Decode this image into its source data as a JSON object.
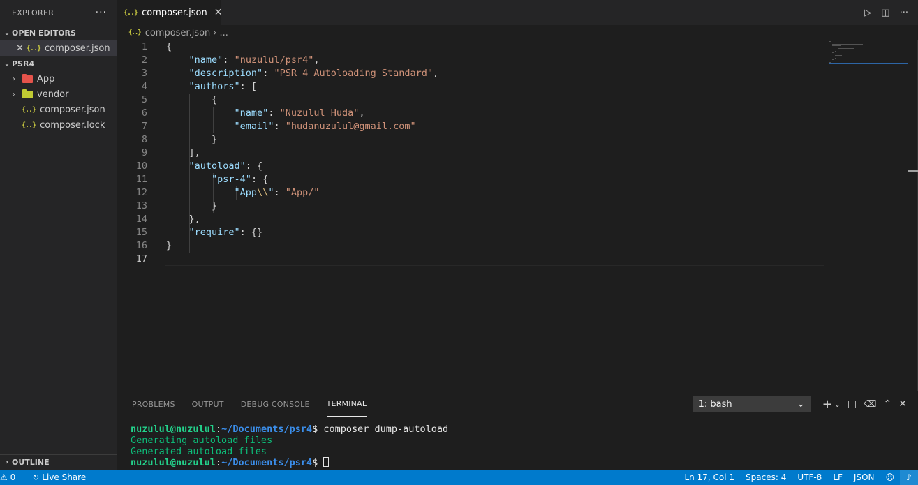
{
  "sidebar": {
    "title": "EXPLORER",
    "more": "···",
    "open_editors": {
      "title": "OPEN EDITORS",
      "items": [
        {
          "icon": "{..}",
          "label": "composer.json"
        }
      ]
    },
    "project": {
      "title": "PSR4",
      "items": [
        {
          "label": "App",
          "type": "folder",
          "color": "#e5534b"
        },
        {
          "label": "vendor",
          "type": "folder",
          "color": "#c0ca33"
        },
        {
          "label": "composer.json",
          "type": "file",
          "icon": "{..}"
        },
        {
          "label": "composer.lock",
          "type": "file",
          "icon": "{..}"
        }
      ]
    },
    "outline": "OUTLINE"
  },
  "editor": {
    "tab": {
      "icon": "{..}",
      "label": "composer.json",
      "close": "✕"
    },
    "actions": {
      "run": "▷",
      "split": "◫",
      "more": "···"
    },
    "breadcrumb": {
      "icon": "{..}",
      "file": "composer.json",
      "sep": "›",
      "more": "..."
    },
    "line_numbers": [
      "1",
      "2",
      "3",
      "4",
      "5",
      "6",
      "7",
      "8",
      "9",
      "10",
      "11",
      "12",
      "13",
      "14",
      "15",
      "16",
      "17"
    ],
    "code": {
      "l1": "{",
      "l2_key": "\"name\"",
      "l2_val": "\"nuzulul/psr4\"",
      "l3_key": "\"description\"",
      "l3_val": "\"PSR 4 Autoloading Standard\"",
      "l4_key": "\"authors\"",
      "l4_rest": ": [",
      "l5": "{",
      "l6_key": "\"name\"",
      "l6_val": "\"Nuzulul Huda\"",
      "l7_key": "\"email\"",
      "l7_val": "\"hudanuzulul@gmail.com\"",
      "l8": "}",
      "l9": "],",
      "l10_key": "\"autoload\"",
      "l10_rest": ": {",
      "l11_key": "\"psr-4\"",
      "l11_rest": ": {",
      "l12_key_a": "\"App",
      "l12_key_esc": "\\\\",
      "l12_key_b": "\"",
      "l12_val": "\"App/\"",
      "l13": "}",
      "l14": "},",
      "l15_key": "\"require\"",
      "l15_rest": ": {}",
      "l16": "}",
      "l17": ""
    }
  },
  "panel": {
    "tabs": [
      "PROBLEMS",
      "OUTPUT",
      "DEBUG CONSOLE",
      "TERMINAL"
    ],
    "active_tab": "TERMINAL",
    "terminal_select": "1: bash",
    "actions": {
      "add": "+",
      "add_dropdown": "⌄",
      "split": "◫",
      "trash": "🗑",
      "maximize": "⌃",
      "close": "✕"
    },
    "terminal": {
      "prompt_user": "nuzulul@nuzulul",
      "prompt_sep": ":",
      "prompt_path": "~/Documents/psr4",
      "prompt_end": "$",
      "command": " composer dump-autoload",
      "output": [
        "Generating autoload files",
        "Generated autoload files"
      ]
    }
  },
  "statusbar": {
    "warnings": "⚠ 0",
    "live_share": "Live Share",
    "position": "Ln 17, Col 1",
    "spaces": "Spaces: 4",
    "encoding": "UTF-8",
    "eol": "LF",
    "language": "JSON"
  }
}
